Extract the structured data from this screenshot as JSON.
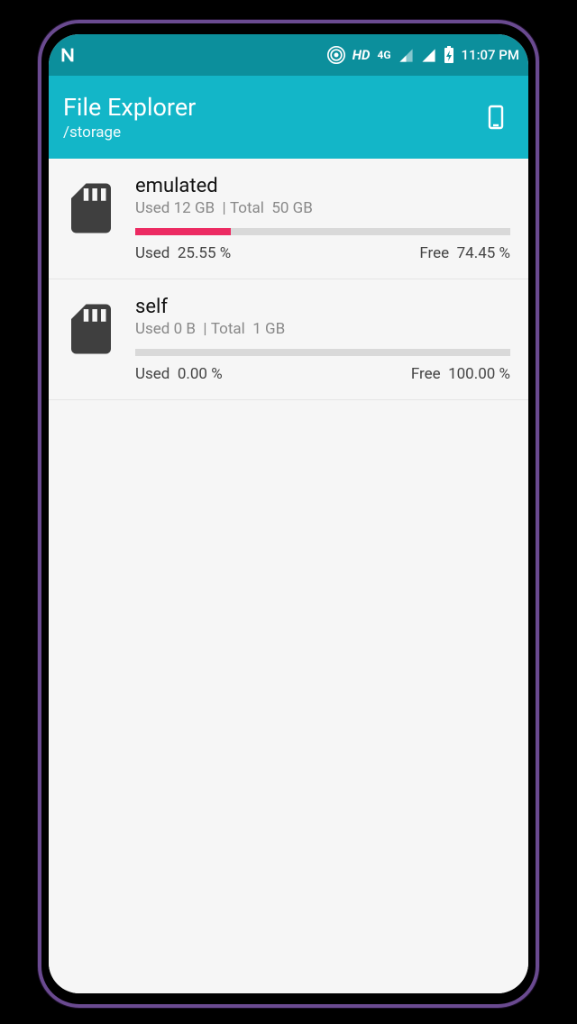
{
  "status": {
    "hd": "HD",
    "net": "4G",
    "time": "11:07 PM"
  },
  "appbar": {
    "title": "File Explorer",
    "path": "/storage"
  },
  "labels": {
    "used": "Used",
    "total": "Total",
    "free": "Free"
  },
  "volumes": [
    {
      "name": "emulated",
      "used_size": "12 GB",
      "total_size": "50 GB",
      "used_pct_num": 25.55,
      "used_pct": "25.55 %",
      "free_pct": "74.45 %"
    },
    {
      "name": "self",
      "used_size": "0 B",
      "total_size": "1 GB",
      "used_pct_num": 0.0,
      "used_pct": "0.00 %",
      "free_pct": "100.00 %"
    }
  ]
}
